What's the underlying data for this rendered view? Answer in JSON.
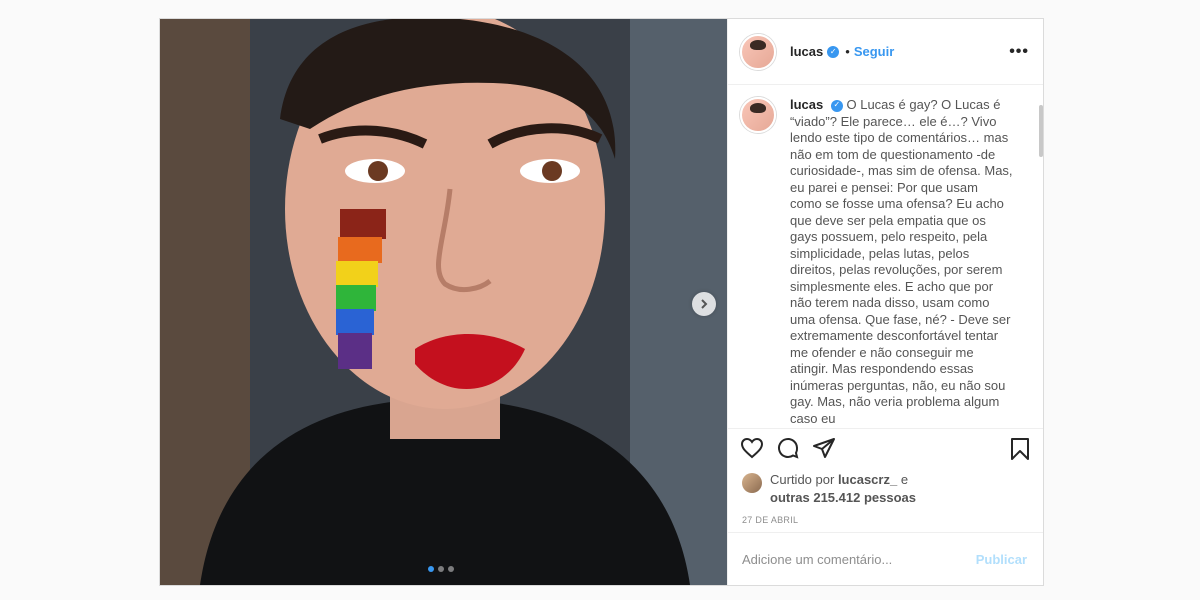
{
  "post": {
    "username": "lucas",
    "separator": "•",
    "follow_label": "Seguir",
    "more_label": "•••",
    "caption": "O Lucas é gay? O Lucas é “viado”? Ele parece… ele é…? Vivo lendo este tipo de comentários… mas não em tom de questionamento -de curiosidade-, mas sim de ofensa. Mas, eu parei e pensei: Por que usam como se fosse uma ofensa? Eu acho que deve ser pela empatia que os gays possuem, pelo respeito, pela simplicidade, pelas lutas, pelos direitos, pelas revoluções, por serem simplesmente eles. E acho que por não terem nada disso, usam como uma ofensa. Que fase, né? - Deve ser extremamente desconfortável tentar me ofender e não conseguir me atingir. Mas respondendo essas inúmeras perguntas, não, eu não sou gay. Mas, não veria problema algum caso eu",
    "likes": {
      "prefix": "Curtido por",
      "user": "lucascrz_",
      "middle": "e",
      "others": "outras 215.412 pessoas"
    },
    "date": "27 DE ABRIL",
    "comment_placeholder": "Adicione um comentário...",
    "publish_label": "Publicar"
  },
  "icons": [
    "heart-icon",
    "comment-icon",
    "share-icon",
    "bookmark-icon",
    "chevron-right-icon",
    "verified-icon"
  ],
  "colors": {
    "accent": "#3897f0",
    "publish_disabled": "#b2dffc"
  }
}
